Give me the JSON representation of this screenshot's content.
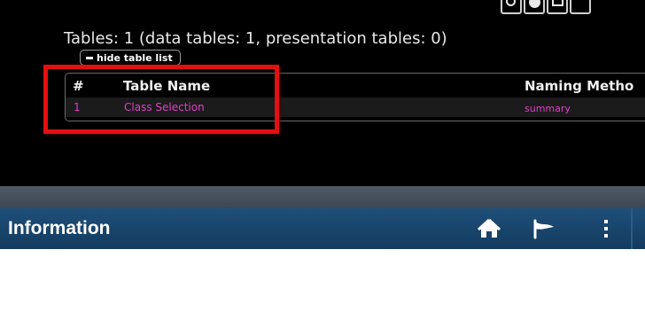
{
  "summary": {
    "text": "Tables: 1 (data tables: 1, presentation tables: 0)"
  },
  "hide_button": {
    "label": "hide table list"
  },
  "table": {
    "headers": [
      "#",
      "Table Name",
      "Naming Metho"
    ],
    "rows": [
      [
        "1",
        "Class Selection",
        "summary"
      ]
    ]
  },
  "info_bar": {
    "title": "Information"
  },
  "colors": {
    "link_pink": "#e040c8",
    "highlight_red": "#e31010",
    "header_blue": "#1f4f7a"
  },
  "icons": [
    "refresh-icon",
    "gear-icon",
    "window-icon",
    "home-icon",
    "flag-icon",
    "more-vertical-icon"
  ]
}
